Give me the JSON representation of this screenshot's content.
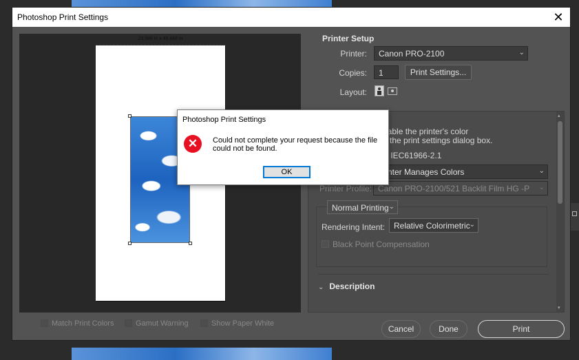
{
  "window": {
    "title": "Photoshop Print Settings",
    "close_glyph": "✕"
  },
  "preview": {
    "dimensions": "23.986 in x 46.486 in"
  },
  "bottom_options": [
    {
      "label": "Match Print Colors"
    },
    {
      "label": "Gamut Warning"
    },
    {
      "label": "Show Paper White"
    }
  ],
  "printer_setup": {
    "title": "Printer Setup",
    "printer_label": "Printer:",
    "printer_value": "Canon PRO-2100",
    "copies_label": "Copies:",
    "copies_value": "1",
    "print_settings_button": "Print Settings...",
    "layout_label": "Layout:"
  },
  "color_management": {
    "title_fragment": "t",
    "note_line1": "nable the printer's color",
    "note_line2": "n the print settings dialog box.",
    "profile_fragment": "B IEC61966-2.1",
    "color_handling": "nter Manages Colors",
    "printer_profile_label": "Printer Profile:",
    "printer_profile_value": "Canon PRO-2100/521 Backlit Film HG -P",
    "printing_mode": "Normal Printing",
    "rendering_intent_label": "Rendering Intent:",
    "rendering_intent_value": "Relative Colorimetric",
    "black_point_label": "Black Point Compensation"
  },
  "description": {
    "title": "Description"
  },
  "footer": {
    "cancel": "Cancel",
    "done": "Done",
    "print": "Print"
  },
  "alert": {
    "title": "Photoshop Print Settings",
    "icon": "✕",
    "message": "Could not complete your request because the file could not be found.",
    "ok": "OK"
  }
}
